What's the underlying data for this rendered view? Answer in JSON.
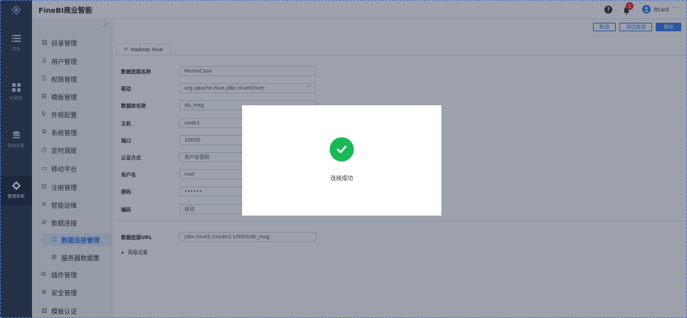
{
  "app": {
    "title": "FineBI商业智能"
  },
  "header": {
    "username": "itcast",
    "notification_count": "1"
  },
  "rail": {
    "items": [
      {
        "label": "目录",
        "icon": "list-icon"
      },
      {
        "label": "仪表板",
        "icon": "dashboard-icon"
      },
      {
        "label": "数据准备",
        "icon": "database-icon"
      },
      {
        "label": "管理系统",
        "icon": "gear-icon"
      }
    ]
  },
  "menu": {
    "items": [
      {
        "label": "目录管理",
        "icon": "▤"
      },
      {
        "label": "用户管理",
        "icon": "♙"
      },
      {
        "label": "权限管理",
        "icon": "⚿"
      },
      {
        "label": "模板管理",
        "icon": "⊞"
      },
      {
        "label": "外观配置",
        "icon": "⚲"
      },
      {
        "label": "系统管理",
        "icon": "⚙"
      },
      {
        "label": "定时调度",
        "icon": "◷"
      },
      {
        "label": "移动平台",
        "icon": "▭"
      },
      {
        "label": "注册管理",
        "icon": "⊟"
      },
      {
        "label": "智能运维",
        "icon": "✕"
      },
      {
        "label": "数据连接",
        "icon": "⊘"
      },
      {
        "label": "数据连接管理",
        "icon": "☷"
      },
      {
        "label": "服务器数据集",
        "icon": "⊞"
      },
      {
        "label": "插件管理",
        "icon": "⧉"
      },
      {
        "label": "安全管理",
        "icon": "⊕"
      },
      {
        "label": "模板认证",
        "icon": "▥"
      }
    ]
  },
  "toolbar": {
    "cancel": "取消",
    "test": "测试连接",
    "save": "保存"
  },
  "connection": {
    "tab_label": "Hadoop Hive",
    "fields": [
      {
        "label": "数据连接名称",
        "value": "MomoCase"
      },
      {
        "label": "驱动",
        "value": "org.apache.hive.jdbc.HiveDriver"
      },
      {
        "label": "数据库名称",
        "value": "db_msg"
      },
      {
        "label": "主机",
        "value": "node1"
      },
      {
        "label": "端口",
        "value": "10000"
      },
      {
        "label": "认证方式",
        "value": "用户名密码"
      },
      {
        "label": "用户名",
        "value": "root"
      },
      {
        "label": "密码",
        "value": "••••••"
      },
      {
        "label": "编码",
        "value": "自动"
      }
    ],
    "url_label": "数据连接URL",
    "url_value": "jdbc:hive2://node1:10000/db_msg",
    "advanced": "高级设置"
  },
  "modal": {
    "message": "连接成功"
  }
}
